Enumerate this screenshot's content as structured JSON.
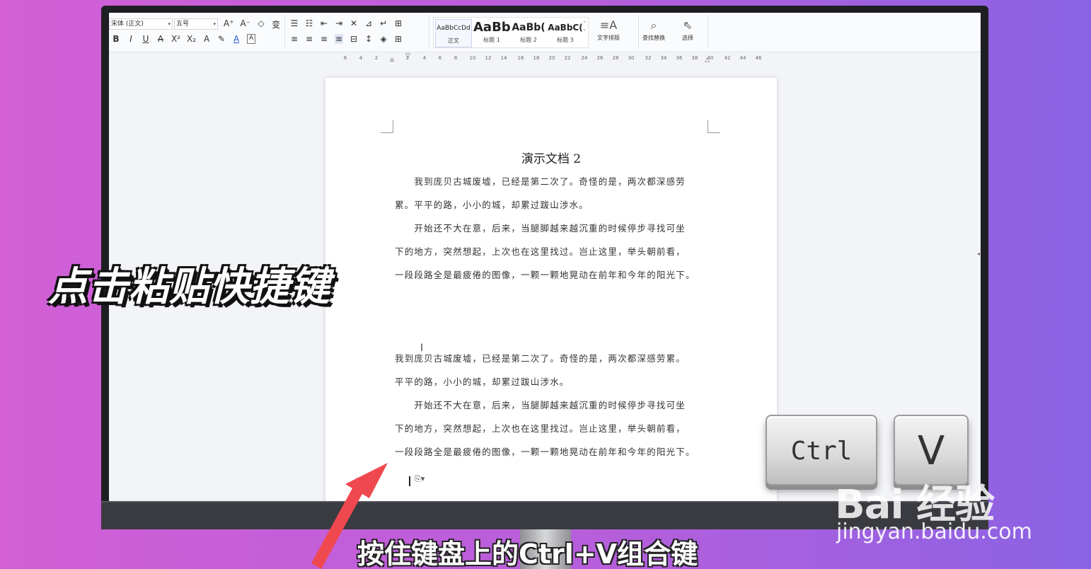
{
  "ribbon": {
    "font_name": "宋体 (正文)",
    "font_size": "五号",
    "format_row1": [
      "A⁺",
      "A⁻",
      "◇",
      "变"
    ],
    "format_row2": [
      "B",
      "I",
      "U",
      "A",
      "X²",
      "X₂",
      "A",
      "✎",
      "A",
      "A"
    ],
    "para_row1": [
      "☰",
      "☷",
      "⇤",
      "⇥",
      "✕",
      "⊿",
      "↵",
      "⊞"
    ],
    "para_row2": [
      "≡",
      "≡",
      "≡",
      "≡",
      "⊟",
      "↕",
      "◈",
      "⊞"
    ],
    "styles": [
      {
        "preview": "AaBbCcDd",
        "name": "正文"
      },
      {
        "preview": "AaBb",
        "name": "标题 1"
      },
      {
        "preview": "AaBb(",
        "name": "标题 2"
      },
      {
        "preview": "AaBbC(",
        "name": "标题 3"
      }
    ],
    "text_layout_label": "文字排版",
    "find_replace_label": "查找替换",
    "select_label": "选择"
  },
  "ruler_ticks": [
    "6",
    "4",
    "2",
    "2",
    "4",
    "6",
    "8",
    "10",
    "12",
    "14",
    "16",
    "18",
    "20",
    "22",
    "24",
    "26",
    "28",
    "30",
    "32",
    "34",
    "36",
    "38",
    "40",
    "42",
    "44",
    "46"
  ],
  "document": {
    "title": "演示文档 2",
    "lines": [
      "　　我到庞贝古城废墟，已经是第二次了。奇怪的是，两次都深感劳",
      "累。平平的路，小小的城，却累过跋山涉水。",
      "　　开始还不大在意，后来，当腿脚越来越沉重的时候停步寻找可坐",
      "下的地方，突然想起，上次也在这里找过。岂止这里，举头朝前看，",
      "一段段路全是最疲倦的图像，一颗一颗地晃动在前年和今年的阳光下。",
      "我到庞贝古城废墟，已经是第二次了。奇怪的是，两次都深感劳累。",
      "平平的路，小小的城，却累过跋山涉水。",
      "　　开始还不大在意，后来，当腿脚越来越沉重的时候停步寻找可坐",
      "下的地方，突然想起，上次也在这里找过。岂止这里，举头朝前看，",
      "一段段路全是最疲倦的图像，一颗一颗地晃动在前年和今年的阳光下。"
    ]
  },
  "overlay": {
    "main_caption": "点击粘贴快捷键",
    "sub_caption": "按住键盘上的Ctrl+V组合键",
    "key_ctrl": "Ctrl",
    "key_v": "V",
    "arrow_color": "#f0484f"
  },
  "watermark": {
    "logo": "Bai 经验",
    "url": "jingyan.baidu.com"
  }
}
